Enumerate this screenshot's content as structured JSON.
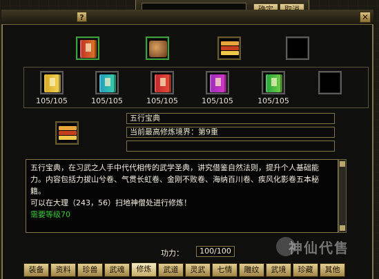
{
  "window": {
    "help_label": "?",
    "close_label": "✕",
    "confirm_label": "确定",
    "cancel_label": "取消"
  },
  "top_row_items": [
    {
      "name": "book-green-red",
      "highlighted": true
    },
    {
      "name": "bundle-scroll",
      "highlighted": false
    },
    {
      "name": "book-stack-gold",
      "highlighted": false
    },
    {
      "name": "empty",
      "highlighted": false
    }
  ],
  "second_row_items": [
    {
      "name": "book-yellow",
      "count": "105/105"
    },
    {
      "name": "book-cyan",
      "count": "105/105"
    },
    {
      "name": "book-red",
      "count": "105/105"
    },
    {
      "name": "book-magenta",
      "count": "105/105"
    },
    {
      "name": "book-green",
      "count": "105/105"
    },
    {
      "name": "empty",
      "count": ""
    }
  ],
  "selected": {
    "name": "五行宝典",
    "realm": "当前最高修炼境界：第9重",
    "extra": ""
  },
  "description": {
    "body": "五行宝典，在习武之人手中代代相传的武学圣典，讲究借鉴自然法则，提升个人基础能力。内容包括力拔山兮卷、气贯长虹卷、金刚不败卷、海纳百川卷、疾风化影卷五本秘籍。",
    "location": "可以在大理（243，56）扫地神僧处进行修炼！",
    "requirement": "需要等级70"
  },
  "power": {
    "label": "功力：",
    "value": "100/100"
  },
  "tabs": [
    "装备",
    "资料",
    "珍兽",
    "武魂",
    "修炼",
    "武道",
    "灵武",
    "七情",
    "雕纹",
    "武境",
    "珍藏",
    "其他"
  ],
  "active_tab": "修炼",
  "watermark": "神仙代售",
  "colors": {
    "frame": "#857648",
    "requirement": "#38c838",
    "tab": "#e3cf92"
  }
}
